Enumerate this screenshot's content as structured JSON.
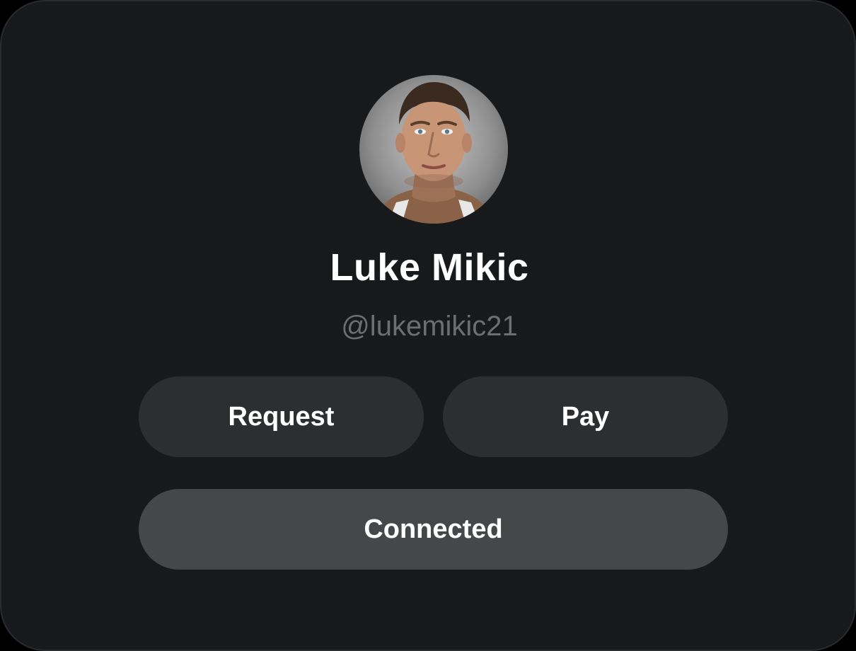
{
  "profile": {
    "avatar_alt": "Profile photo of Luke Mikic",
    "name": "Luke Mikic",
    "handle": "@lukemikic21"
  },
  "actions": {
    "request_label": "Request",
    "pay_label": "Pay",
    "connected_label": "Connected"
  },
  "colors": {
    "background": "#18191b",
    "secondary_button": "#2d2e30",
    "connected_button": "#464749",
    "handle_text": "#6d6e71",
    "primary_text": "#ffffff"
  }
}
